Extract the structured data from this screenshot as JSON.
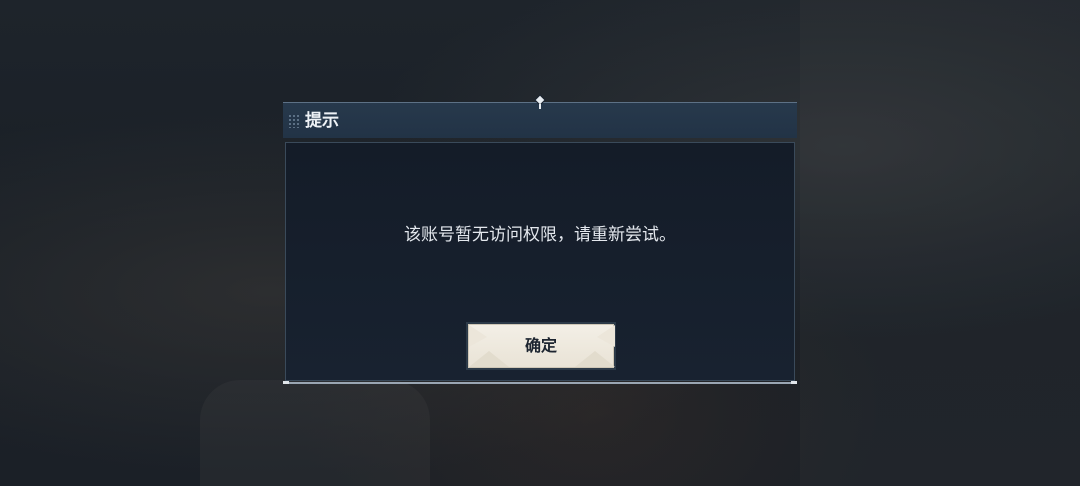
{
  "dialog": {
    "title": "提示",
    "message": "该账号暂无访问权限，请重新尝试。",
    "confirm_label": "确定"
  },
  "colors": {
    "header_bg": "#223346",
    "body_bg": "#182230",
    "button_bg": "#efeae0",
    "text_light": "#e4e8ee",
    "text_dark": "#1d2530"
  },
  "icons": {
    "header_grip": "dotted-grip-icon",
    "top_pin": "diamond-pin-icon"
  }
}
